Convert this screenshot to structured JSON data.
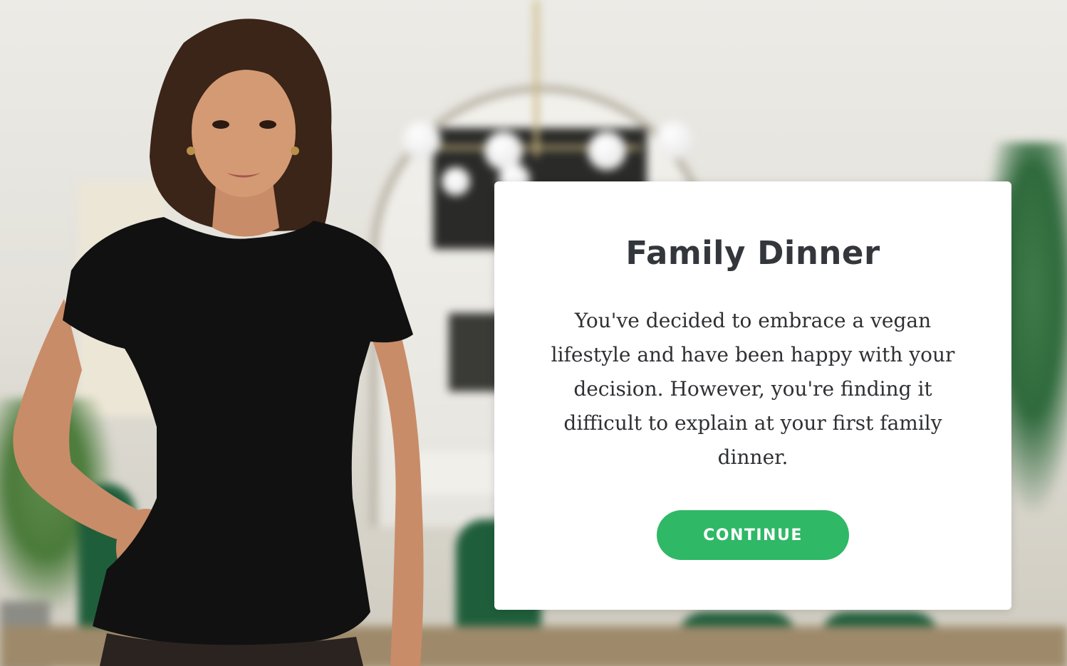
{
  "scenario": {
    "title": "Family Dinner",
    "description": "You've decided to embrace a vegan lifestyle and have been happy with your decision. However, you're finding it difficult to explain at your first family dinner.",
    "continue_label": "CONTINUE"
  },
  "colors": {
    "button": "#2fb866",
    "title_text": "#33363b",
    "card_background": "#ffffff"
  }
}
